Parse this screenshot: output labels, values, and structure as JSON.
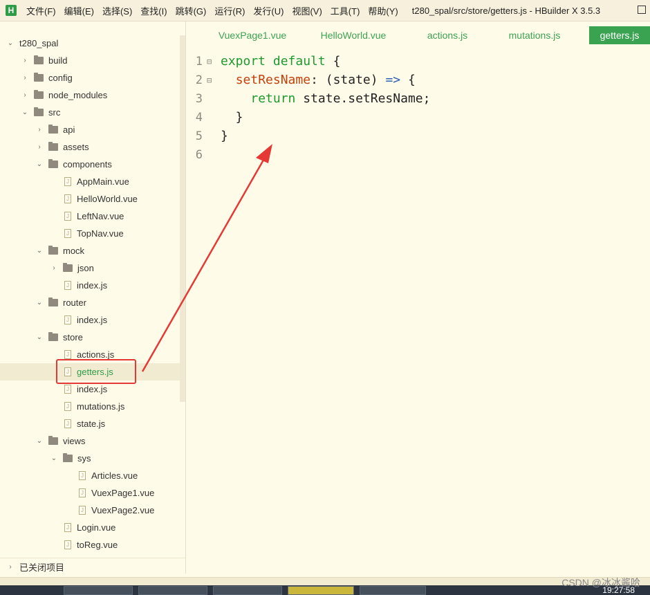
{
  "app": {
    "menus": [
      "文件(F)",
      "编辑(E)",
      "选择(S)",
      "查找(I)",
      "跳转(G)",
      "运行(R)",
      "发行(U)",
      "视图(V)",
      "工具(T)",
      "帮助(Y)"
    ],
    "window_title": "t280_spal/src/store/getters.js - HBuilder X 3.5.3",
    "logo_letter": "H"
  },
  "sidebar": {
    "tree": [
      {
        "label": "t280_spal",
        "kind": "project",
        "expanded": true
      },
      {
        "label": "build",
        "kind": "folder",
        "expanded": false
      },
      {
        "label": "config",
        "kind": "folder",
        "expanded": false
      },
      {
        "label": "node_modules",
        "kind": "folder",
        "expanded": false
      },
      {
        "label": "src",
        "kind": "folder",
        "expanded": true
      },
      {
        "label": "api",
        "kind": "folder",
        "expanded": false
      },
      {
        "label": "assets",
        "kind": "folder",
        "expanded": false
      },
      {
        "label": "components",
        "kind": "folder",
        "expanded": true
      },
      {
        "label": "AppMain.vue",
        "kind": "file"
      },
      {
        "label": "HelloWorld.vue",
        "kind": "file"
      },
      {
        "label": "LeftNav.vue",
        "kind": "file"
      },
      {
        "label": "TopNav.vue",
        "kind": "file"
      },
      {
        "label": "mock",
        "kind": "folder",
        "expanded": true
      },
      {
        "label": "json",
        "kind": "folder",
        "expanded": false
      },
      {
        "label": "index.js",
        "kind": "file"
      },
      {
        "label": "router",
        "kind": "folder",
        "expanded": true
      },
      {
        "label": "index.js",
        "kind": "file"
      },
      {
        "label": "store",
        "kind": "folder",
        "expanded": true
      },
      {
        "label": "actions.js",
        "kind": "file"
      },
      {
        "label": "getters.js",
        "kind": "file",
        "selected": true
      },
      {
        "label": "index.js",
        "kind": "file"
      },
      {
        "label": "mutations.js",
        "kind": "file"
      },
      {
        "label": "state.js",
        "kind": "file"
      },
      {
        "label": "views",
        "kind": "folder",
        "expanded": true
      },
      {
        "label": "sys",
        "kind": "folder",
        "expanded": true
      },
      {
        "label": "Articles.vue",
        "kind": "file"
      },
      {
        "label": "VuexPage1.vue",
        "kind": "file"
      },
      {
        "label": "VuexPage2.vue",
        "kind": "file"
      },
      {
        "label": "Login.vue",
        "kind": "file"
      },
      {
        "label": "toReg.vue",
        "kind": "file"
      }
    ],
    "closed_projects_label": "已关闭项目"
  },
  "tabs": [
    {
      "label": "VuexPage1.vue",
      "active": false
    },
    {
      "label": "HelloWorld.vue",
      "active": false
    },
    {
      "label": "actions.js",
      "active": false
    },
    {
      "label": "mutations.js",
      "active": false
    },
    {
      "label": "getters.js",
      "active": true
    }
  ],
  "editor": {
    "lines": [
      {
        "no": "1",
        "fold": "⊟",
        "tokens": [
          [
            "kw",
            "export default "
          ],
          [
            "pl",
            "{"
          ]
        ]
      },
      {
        "no": "2",
        "fold": "⊟",
        "tokens": [
          [
            "pl",
            "  "
          ],
          [
            "fn",
            "setResName"
          ],
          [
            "pl",
            ": (state) "
          ],
          [
            "op",
            "=>"
          ],
          [
            "pl",
            " {"
          ]
        ]
      },
      {
        "no": "3",
        "fold": "",
        "tokens": [
          [
            "pl",
            "    "
          ],
          [
            "rt",
            "return"
          ],
          [
            "pl",
            " state.setResName;"
          ]
        ]
      },
      {
        "no": "4",
        "fold": "",
        "tokens": [
          [
            "pl",
            "  }"
          ]
        ]
      },
      {
        "no": "5",
        "fold": "",
        "tokens": [
          [
            "pl",
            "}"
          ]
        ]
      },
      {
        "no": "6",
        "fold": "",
        "tokens": []
      }
    ]
  },
  "taskbar": {
    "clock": "19:27:58"
  },
  "watermark": "CSDN @冰冰酱哈",
  "colors": {
    "accent": "#3aa351",
    "annotation": "#e53935",
    "background": "#fffbe9"
  }
}
